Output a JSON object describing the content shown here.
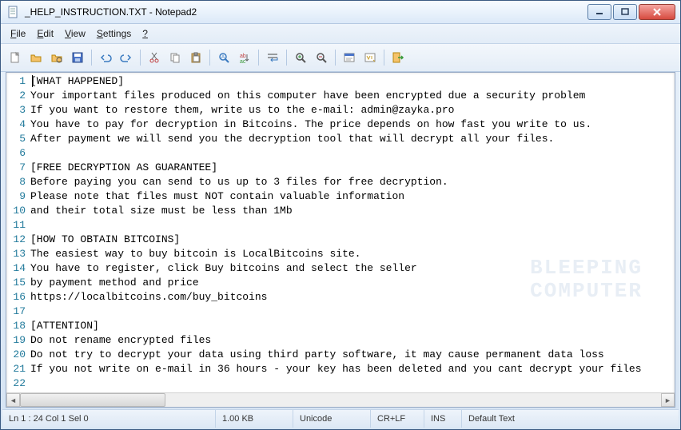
{
  "window": {
    "title": "_HELP_INSTRUCTION.TXT - Notepad2"
  },
  "menu": {
    "file": "File",
    "edit": "Edit",
    "view": "View",
    "settings": "Settings",
    "help": "?"
  },
  "toolbar_icons": [
    "new-file-icon",
    "open-file-icon",
    "browse-icon",
    "save-icon",
    "sep",
    "undo-icon",
    "redo-icon",
    "sep",
    "cut-icon",
    "copy-icon",
    "paste-icon",
    "sep",
    "find-icon",
    "replace-icon",
    "sep",
    "word-wrap-icon",
    "sep",
    "zoom-in-icon",
    "zoom-out-icon",
    "sep",
    "scheme-icon",
    "customize-icon",
    "sep",
    "exit-icon"
  ],
  "lines": [
    "[WHAT HAPPENED]",
    "Your important files produced on this computer have been encrypted due a security problem",
    "If you want to restore them, write us to the e-mail: admin@zayka.pro",
    "You have to pay for decryption in Bitcoins. The price depends on how fast you write to us.",
    "After payment we will send you the decryption tool that will decrypt all your files.",
    "",
    "[FREE DECRYPTION AS GUARANTEE]",
    "Before paying you can send to us up to 3 files for free decryption.",
    "Please note that files must NOT contain valuable information",
    "and their total size must be less than 1Mb",
    "",
    "[HOW TO OBTAIN BITCOINS]",
    "The easiest way to buy bitcoin is LocalBitcoins site.",
    "You have to register, click Buy bitcoins and select the seller",
    "by payment method and price",
    "https://localbitcoins.com/buy_bitcoins",
    "",
    "[ATTENTION]",
    "Do not rename encrypted files",
    "Do not try to decrypt your data using third party software, it may cause permanent data loss",
    "If you not write on e-mail in 36 hours - your key has been deleted and you cant decrypt your files",
    "",
    "",
    ""
  ],
  "status": {
    "pos": "Ln 1 : 24   Col 1   Sel 0",
    "size": "1.00 KB",
    "encoding": "Unicode",
    "eol": "CR+LF",
    "mode": "INS",
    "filetype": "Default Text"
  },
  "watermark": {
    "l1": "BLEEPING",
    "l2": "COMPUTER"
  }
}
